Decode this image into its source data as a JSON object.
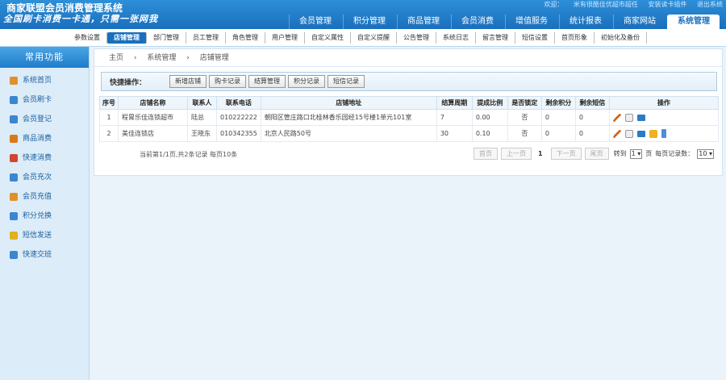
{
  "header": {
    "title": "商家联盟会员消费管理系统",
    "slogan": "全国刷卡消费一卡通，只需一张网我",
    "top_links": [
      "欢迎：",
      "米有很酷佳优超市超任",
      "安装读卡插件",
      "退出系统"
    ],
    "nav": [
      {
        "label": "会员管理",
        "active": false
      },
      {
        "label": "积分管理",
        "active": false
      },
      {
        "label": "商品管理",
        "active": false
      },
      {
        "label": "会员消费",
        "active": false
      },
      {
        "label": "增值服务",
        "active": false
      },
      {
        "label": "统计报表",
        "active": false
      },
      {
        "label": "商家网站",
        "active": false
      },
      {
        "label": "系统管理",
        "active": true
      }
    ]
  },
  "subnav": [
    {
      "label": "参数设置",
      "active": false
    },
    {
      "label": "店铺管理",
      "active": true
    },
    {
      "label": "部门管理",
      "active": false
    },
    {
      "label": "员工管理",
      "active": false
    },
    {
      "label": "角色管理",
      "active": false
    },
    {
      "label": "用户管理",
      "active": false
    },
    {
      "label": "自定义属性",
      "active": false
    },
    {
      "label": "自定义提醒",
      "active": false
    },
    {
      "label": "公告管理",
      "active": false
    },
    {
      "label": "系统日志",
      "active": false
    },
    {
      "label": "留言管理",
      "active": false
    },
    {
      "label": "短信设置",
      "active": false
    },
    {
      "label": "首页形象",
      "active": false
    },
    {
      "label": "初始化及备份",
      "active": false
    }
  ],
  "sidebar": {
    "title": "常用功能",
    "items": [
      {
        "label": "系统首页",
        "icon": "home-icon",
        "color": "#e0902a"
      },
      {
        "label": "会员刷卡",
        "icon": "user-card-icon",
        "color": "#3a86d0"
      },
      {
        "label": "会员登记",
        "icon": "user-register-icon",
        "color": "#3a86d0"
      },
      {
        "label": "商品消费",
        "icon": "cart-icon",
        "color": "#d87a1a"
      },
      {
        "label": "快速消费",
        "icon": "fast-pay-icon",
        "color": "#d0472a"
      },
      {
        "label": "会员充次",
        "icon": "recharge-times-icon",
        "color": "#3a86d0"
      },
      {
        "label": "会员充值",
        "icon": "recharge-icon",
        "color": "#e0902a"
      },
      {
        "label": "积分兑换",
        "icon": "points-icon",
        "color": "#3a86d0"
      },
      {
        "label": "短信发送",
        "icon": "sms-icon",
        "color": "#e0b020"
      },
      {
        "label": "快速交班",
        "icon": "shift-icon",
        "color": "#3a86d0"
      }
    ]
  },
  "breadcrumb": [
    "主页",
    "›",
    "系统管理",
    "›",
    "店铺管理"
  ],
  "quick_ops": {
    "label": "快捷操作：",
    "buttons": [
      "新增店铺",
      "购卡记录",
      "结算管理",
      "积分记录",
      "短信记录"
    ]
  },
  "table": {
    "headers": [
      "序号",
      "店铺名称",
      "联系人",
      "联系电话",
      "店铺地址",
      "结算周期",
      "提成比例",
      "是否锁定",
      "剩余积分",
      "剩余短信",
      "操作"
    ],
    "rows": [
      [
        "1",
        "程胃乐佳连锁超市",
        "陆总",
        "010222222",
        "朝阳区管庄路口北桂林香乐园经15号楼1单元101室",
        "7",
        "0.00",
        "否",
        "0",
        "0"
      ],
      [
        "2",
        "美佳连锁店",
        "王晓东",
        "010342355",
        "北京人民路50号",
        "30",
        "0.10",
        "否",
        "0",
        "0"
      ]
    ]
  },
  "pager": {
    "info": "当前第1/1页,共2条记录 每页10条",
    "first": "首页",
    "prev": "上一页",
    "current": "1",
    "next": "下一页",
    "last": "尾页",
    "goto_label": "转到",
    "goto_value": "1",
    "page_unit": "页",
    "per_page_label": "每页记录数：",
    "per_page_value": "10"
  }
}
